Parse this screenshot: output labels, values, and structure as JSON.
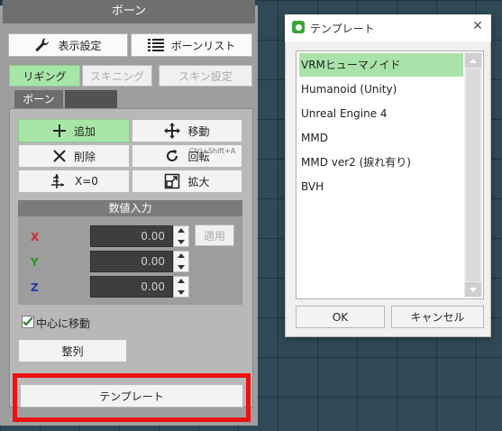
{
  "bone_panel": {
    "title": "ボーン",
    "display_settings_label": "表示設定",
    "bone_list_label": "ボーンリスト",
    "mode_tabs": [
      "リギング",
      "スキニング",
      "スキン設定"
    ],
    "sub_tab_label": "ボーン",
    "tools": {
      "add": "追加",
      "move": "移動",
      "delete": "削除",
      "rotate": "回転",
      "rotate_shortcut": "Ctrl+Shift+A",
      "x0": "X=0",
      "scale": "拡大"
    },
    "numeric_input": {
      "title": "数値入力",
      "apply_label": "適用",
      "fields": [
        {
          "axis": "X",
          "value": "0.00",
          "color": "#d42a2a"
        },
        {
          "axis": "Y",
          "value": "0.00",
          "color": "#1e9a1e"
        },
        {
          "axis": "Z",
          "value": "0.00",
          "color": "#2a35b4"
        }
      ]
    },
    "move_to_center_label": "中心に移動",
    "move_to_center_checked": true,
    "align_label": "整列",
    "template_label": "テンプレート"
  },
  "template_dialog": {
    "title": "テンプレート",
    "close_glyph": "✕",
    "items": [
      "VRMヒューマノイド",
      "Humanoid (Unity)",
      "Unreal Engine 4",
      "MMD",
      "MMD ver2 (捩れ有り)",
      "BVH"
    ],
    "selected_index": 0,
    "ok_label": "OK",
    "cancel_label": "キャンセル"
  },
  "colors": {
    "accent_green": "#a7e6a7",
    "highlight_red": "#ee1111"
  }
}
